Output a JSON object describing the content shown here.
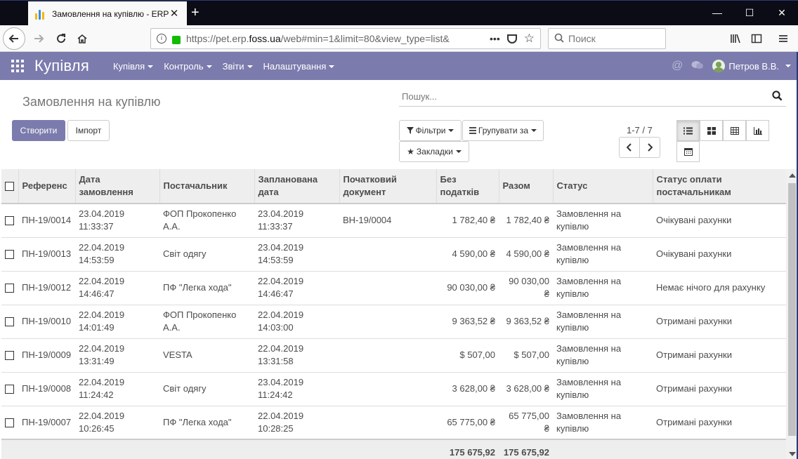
{
  "browser": {
    "tab_title": "Замовлення на купівлю - ERP",
    "url_prefix": "https://pet.erp.",
    "url_domain": "foss.ua",
    "url_suffix": "/web#min=1&limit=80&view_type=list&",
    "search_placeholder": "Поиск"
  },
  "app": {
    "title": "Купівля",
    "menu": [
      "Купівля",
      "Контроль",
      "Звіти",
      "Налаштування"
    ],
    "user": "Петров В.В.",
    "accent_color": "#7c7bad"
  },
  "control": {
    "page_title": "Замовлення на купівлю",
    "search_placeholder": "Пошук...",
    "create_label": "Створити",
    "import_label": "Імпорт",
    "filters_label": "Фільтри",
    "group_label": "Групувати за",
    "favorites_label": "Закладки",
    "pager": "1-7 / 7"
  },
  "table": {
    "columns": [
      "Референс",
      "Дата замовлення",
      "Постачальник",
      "Запланована дата",
      "Початковий документ",
      "Без податків",
      "Разом",
      "Статус",
      "Статус оплати постачальникам"
    ],
    "rows": [
      [
        "ПН-19/0014",
        "23.04.2019 11:33:37",
        "ФОП Прокопенко А.А.",
        "23.04.2019 11:33:37",
        "ВН-19/0004",
        "1 782,40 ₴",
        "1 782,40 ₴",
        "Замовлення на купівлю",
        "Очікувані рахунки"
      ],
      [
        "ПН-19/0013",
        "22.04.2019 14:53:59",
        "Світ одягу",
        "23.04.2019 14:53:59",
        "",
        "4 590,00 ₴",
        "4 590,00 ₴",
        "Замовлення на купівлю",
        "Очікувані рахунки"
      ],
      [
        "ПН-19/0012",
        "22.04.2019 14:46:47",
        "ПФ \"Легка хода\"",
        "22.04.2019 14:46:47",
        "",
        "90 030,00 ₴",
        "90 030,00 ₴",
        "Замовлення на купівлю",
        "Немає нічого для рахунку"
      ],
      [
        "ПН-19/0010",
        "22.04.2019 14:01:49",
        "ФОП Прокопенко А.А.",
        "22.04.2019 14:03:00",
        "",
        "9 363,52 ₴",
        "9 363,52 ₴",
        "Замовлення на купівлю",
        "Отримані рахунки"
      ],
      [
        "ПН-19/0009",
        "22.04.2019 13:31:49",
        "VESTA",
        "22.04.2019 13:31:58",
        "",
        "$ 507,00",
        "$ 507,00",
        "Замовлення на купівлю",
        "Отримані рахунки"
      ],
      [
        "ПН-19/0008",
        "22.04.2019 11:24:42",
        "Світ одягу",
        "23.04.2019 11:24:42",
        "",
        "3 628,00 ₴",
        "3 628,00 ₴",
        "Замовлення на купівлю",
        "Отримані рахунки"
      ],
      [
        "ПН-19/0007",
        "22.04.2019 10:26:45",
        "ПФ \"Легка хода\"",
        "22.04.2019 10:28:25",
        "",
        "65 775,00 ₴",
        "65 775,00 ₴",
        "Замовлення на купівлю",
        "Отримані рахунки"
      ]
    ],
    "totals": {
      "untaxed": "175 675,92",
      "total": "175 675,92"
    }
  }
}
